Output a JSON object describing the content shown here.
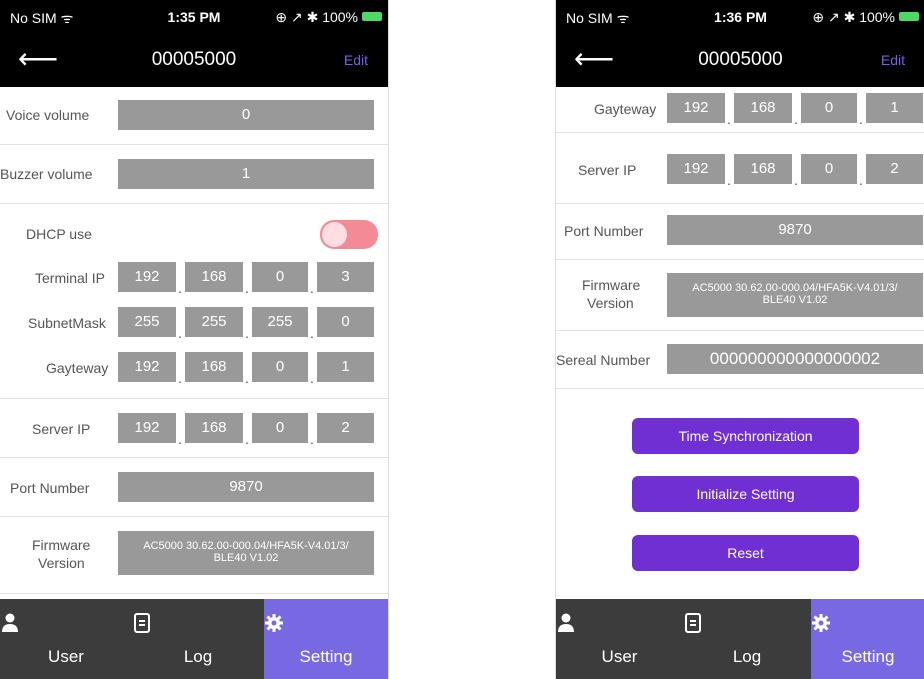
{
  "left": {
    "status": {
      "carrier": "No SIM ᯤ",
      "time": "1:35 PM",
      "right": "⊕ ↗ ✱ 100%"
    },
    "nav": {
      "back": "⟵",
      "title": "00005000",
      "edit": "Edit"
    },
    "voice_volume": {
      "label": "Voice volume",
      "value": "0"
    },
    "buzzer_volume": {
      "label": "Buzzer volume",
      "value": "1"
    },
    "dhcp": {
      "label": "DHCP use"
    },
    "terminal_ip": {
      "label": "Terminal IP",
      "octets": [
        "192",
        "168",
        "0",
        "3"
      ]
    },
    "subnet": {
      "label": "SubnetMask",
      "octets": [
        "255",
        "255",
        "255",
        "0"
      ]
    },
    "gateway": {
      "label": "Gayteway",
      "octets": [
        "192",
        "168",
        "0",
        "1"
      ]
    },
    "server_ip": {
      "label": "Server IP",
      "octets": [
        "192",
        "168",
        "0",
        "2"
      ]
    },
    "port": {
      "label": "Port Number",
      "value": "9870"
    },
    "firmware": {
      "label1": "Firmware",
      "label2": "Version",
      "line1": "AC5000 30.62.00-000.04/HFA5K-V4.01/3/",
      "line2": "BLE40 V1.02"
    },
    "tabs": [
      {
        "label": "User",
        "icon": "user-icon"
      },
      {
        "label": "Log",
        "icon": "log-icon"
      },
      {
        "label": "Setting",
        "icon": "gear-icon"
      }
    ]
  },
  "right": {
    "status": {
      "carrier": "No SIM ᯤ",
      "time": "1:36 PM",
      "right": "⊕ ↗ ✱ 100%"
    },
    "nav": {
      "back": "⟵",
      "title": "00005000",
      "edit": "Edit"
    },
    "gateway": {
      "label": "Gayteway",
      "octets": [
        "192",
        "168",
        "0",
        "1"
      ]
    },
    "server_ip": {
      "label": "Server IP",
      "octets": [
        "192",
        "168",
        "0",
        "2"
      ]
    },
    "port": {
      "label": "Port Number",
      "value": "9870"
    },
    "firmware": {
      "label1": "Firmware",
      "label2": "Version",
      "line1": "AC5000 30.62.00-000.04/HFA5K-V4.01/3/",
      "line2": "BLE40 V1.02"
    },
    "serial": {
      "label": "Sereal Number",
      "value": "000000000000000002"
    },
    "buttons": {
      "time_sync": "Time Synchronization",
      "init": "Initialize Setting",
      "reset": "Reset"
    },
    "tabs": [
      {
        "label": "User",
        "icon": "user-icon"
      },
      {
        "label": "Log",
        "icon": "log-icon"
      },
      {
        "label": "Setting",
        "icon": "gear-icon"
      }
    ]
  },
  "colors": {
    "accent": "#6f2fd3",
    "tab_active": "#7868e2",
    "field": "#999999",
    "toggle": "#f38a96"
  }
}
